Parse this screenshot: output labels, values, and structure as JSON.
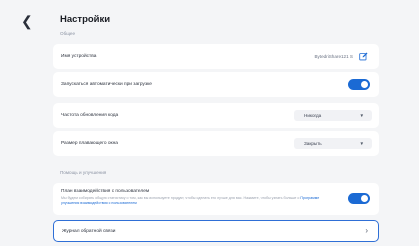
{
  "header": {
    "title": "Настройки"
  },
  "sections": {
    "general": "Общее",
    "help": "Помощь и улучшения"
  },
  "device_name": {
    "label": "Имя устройства",
    "value": "BytedriShare121 S"
  },
  "autostart": {
    "label": "Запускаться автоматически при загрузке",
    "enabled": true
  },
  "refresh_rate": {
    "label": "Частота обновления кода",
    "value": "Никогда"
  },
  "floating_window": {
    "label": "Размер плавающего окна",
    "value": "Закрыть"
  },
  "interaction_plan": {
    "label": "План взаимодействия с пользователем",
    "description": "Мы будем собирать общую статистику о том, как вы используете продукт, чтобы сделать его лучше для вас. Нажмите, чтобы узнать больше о",
    "link": "Программе улучшения взаимодействия с пользователем",
    "enabled": true
  },
  "feedback": {
    "label": "Журнал обратной связи"
  },
  "colors": {
    "accent": "#1b6ad4",
    "background": "#f4f5f7",
    "card": "#ffffff"
  }
}
